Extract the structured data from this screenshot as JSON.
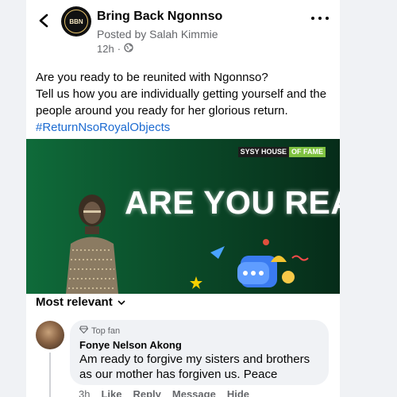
{
  "post": {
    "page_name": "Bring Back Ngonnso",
    "posted_by": "Posted by Salah Kimmie",
    "time": "12h",
    "avatar_text": "BBN",
    "body_line1": "Are you ready to be reunited with Ngonnso?",
    "body_line2": "Tell us how you are individually getting yourself and the people around you ready for her glorious return.",
    "hashtag": "#ReturnNsoRoyalObjects"
  },
  "banner": {
    "brand_part1": "SYSY HOUSE",
    "brand_part2": "OF FAME",
    "headline": "ARE YOU READY?"
  },
  "comments": {
    "sort_label": "Most relevant",
    "items": [
      {
        "badge": "Top fan",
        "name": "Fonye Nelson Akong",
        "text": "Am ready to forgive my sisters and brothers as our mother has forgiven us. Peace",
        "time": "3h",
        "like": "Like",
        "reply": "Reply",
        "message": "Message",
        "hide": "Hide"
      }
    ]
  },
  "icons": [
    "back-arrow-icon",
    "more-icon",
    "globe-icon",
    "chevron-down-icon",
    "diamond-icon"
  ],
  "colors": {
    "link": "#1c6bd1",
    "banner_green": "#0f6b3a",
    "muted": "#65676b"
  }
}
